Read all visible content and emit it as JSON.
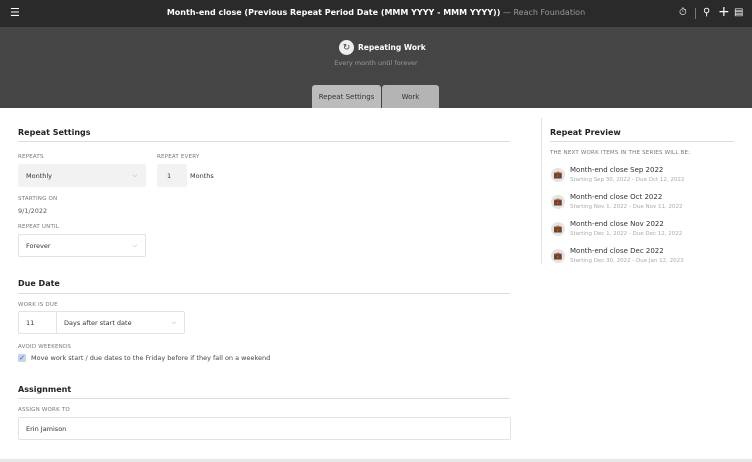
{
  "header": {
    "title": "Month-end close (Previous Repeat Period Date (MMM YYYY - MMM YYYY))",
    "org": " — Reach Foundation"
  },
  "banner": {
    "title": "Repeating Work",
    "subtitle": "Every month until forever"
  },
  "tabs": [
    {
      "label": "Repeat Settings"
    },
    {
      "label": "Work"
    }
  ],
  "repeat": {
    "heading": "Repeat Settings",
    "repeats_label": "Repeats",
    "repeats_value": "Monthly",
    "every_label": "Repeat Every",
    "every_value": "1",
    "every_unit": "Months",
    "start_label": "Starting On",
    "start_value": "9/1/2022",
    "until_label": "Repeat Until",
    "until_value": "Forever"
  },
  "due": {
    "heading": "Due Date",
    "label": "Work Is Due",
    "days": "11",
    "mode": "Days after start date",
    "weekend_label": "Avoid Weekends",
    "weekend_text": "Move work start / due dates to the Friday before if they fall on a weekend"
  },
  "assignment": {
    "heading": "Assignment",
    "label": "Assign Work To",
    "value": "Erin Jamison"
  },
  "preview": {
    "heading": "Repeat Preview",
    "label": "The next work items in the series will be:",
    "items": [
      {
        "title": "Month-end close Sep 2022",
        "dates": "Starting Sep 30, 2022 - Due Oct 12, 2022"
      },
      {
        "title": "Month-end close Oct 2022",
        "dates": "Starting Nov 1, 2022 - Due Nov 11, 2022"
      },
      {
        "title": "Month-end close Nov 2022",
        "dates": "Starting Dec 1, 2022 - Due Dec 12, 2022"
      },
      {
        "title": "Month-end close Dec 2022",
        "dates": "Starting Dec 30, 2022 - Due Jan 12, 2023"
      }
    ]
  }
}
